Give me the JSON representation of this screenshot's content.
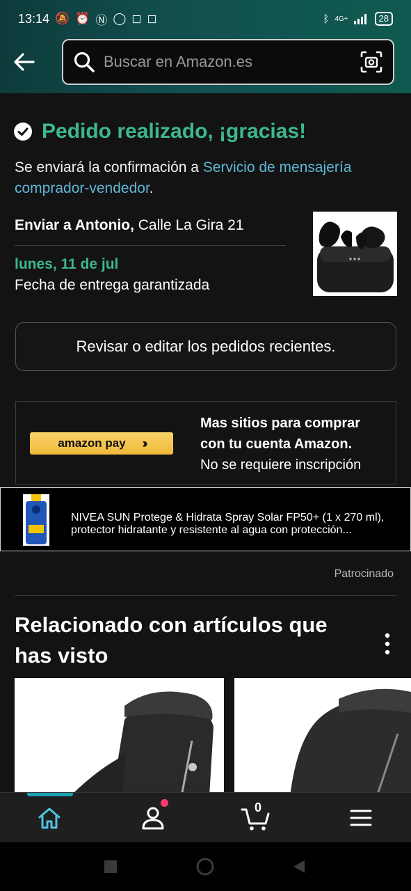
{
  "status_bar": {
    "time": "13:14",
    "network": "4G+",
    "battery": "28",
    "left_icons": [
      "mute-icon",
      "alarm-icon",
      "nfc-icon",
      "whatsapp-icon",
      "instagram-icon",
      "instagram-icon"
    ],
    "right_icons": [
      "bluetooth-icon",
      "signal-icon",
      "battery-icon"
    ]
  },
  "header": {
    "search_placeholder": "Buscar en Amazon.es"
  },
  "confirmation": {
    "title": "Pedido realizado, ¡gracias!",
    "message_prefix": "Se enviará la confirmación a ",
    "message_link": "Servicio de mensajería comprador-vendedor",
    "message_suffix": ".",
    "ship_to_label": "Enviar a Antonio,",
    "ship_to_address": " Calle La Gira 21",
    "delivery_date": "lunes, 11 de jul",
    "delivery_note": "Fecha de entrega garantizada",
    "review_button": "Revisar o editar los pedidos recientes."
  },
  "amazon_pay": {
    "button_label": "amazon pay",
    "line1": "Mas sitios para comprar",
    "line2": "con tu cuenta Amazon.",
    "line3": "No se requiere inscripción"
  },
  "sponsored_ad": {
    "line1": "NIVEA SUN Protege & Hidrata Spray Solar FP50+ (1 x 270 ml),",
    "line2": "protector hidratante y resistente al agua con protección...",
    "sponsored_label": "Patrocinado"
  },
  "related": {
    "title": "Relacionado con artículos que has visto"
  },
  "bottom_nav": {
    "cart_count": "0",
    "items": [
      "home-icon",
      "account-icon",
      "cart-icon",
      "menu-icon"
    ]
  },
  "colors": {
    "accent_green": "#3db88d",
    "link_blue": "#5fb7d6",
    "header_teal": "#125050"
  }
}
